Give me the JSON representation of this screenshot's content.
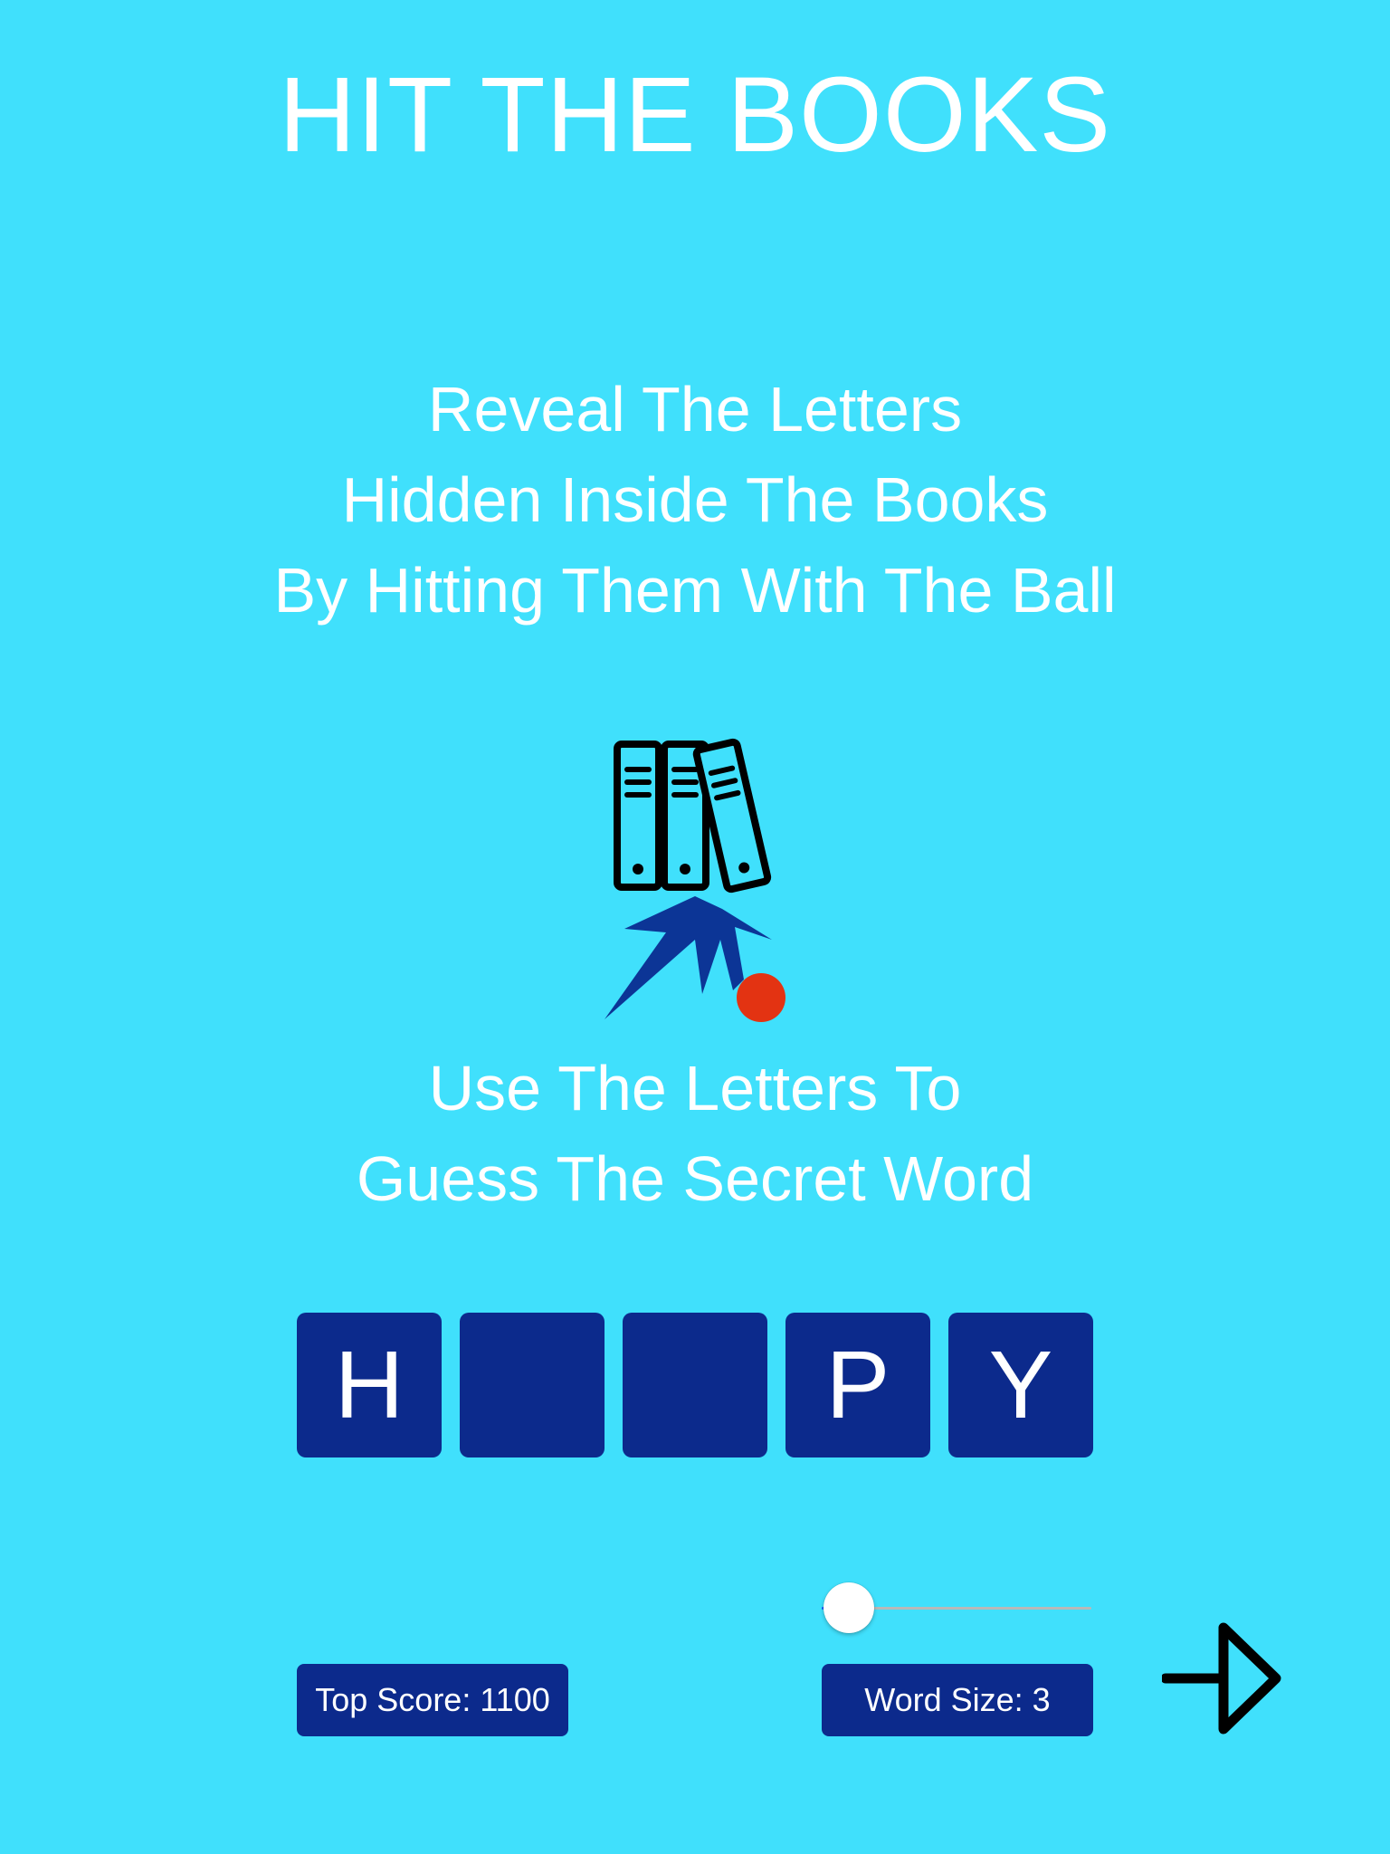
{
  "app": {
    "title": "HIT THE BOOKS"
  },
  "instructions": {
    "reveal": [
      "Reveal The Letters",
      "Hidden Inside The Books",
      "By Hitting Them With The Ball"
    ],
    "guess": [
      "Use The Letters To",
      "Guess The Secret Word"
    ]
  },
  "illustration": {
    "icon": "books-and-ball-icon",
    "book_color": "#40e0fc",
    "outline_color": "#000000",
    "burst_color": "#0c3596",
    "ball_color": "#e33312"
  },
  "word_tiles": {
    "letters": [
      "H",
      "",
      "",
      "P",
      "Y"
    ]
  },
  "word_size_slider": {
    "value": 3,
    "position_fraction": 0.0
  },
  "footer": {
    "top_score_label": "Top Score: 1100",
    "word_size_label": "Word Size: 3"
  },
  "next_button": {
    "icon": "arrow-right-icon"
  },
  "colors": {
    "background": "#40e0fc",
    "tile": "#0c2a8c",
    "text": "#ffffff"
  }
}
